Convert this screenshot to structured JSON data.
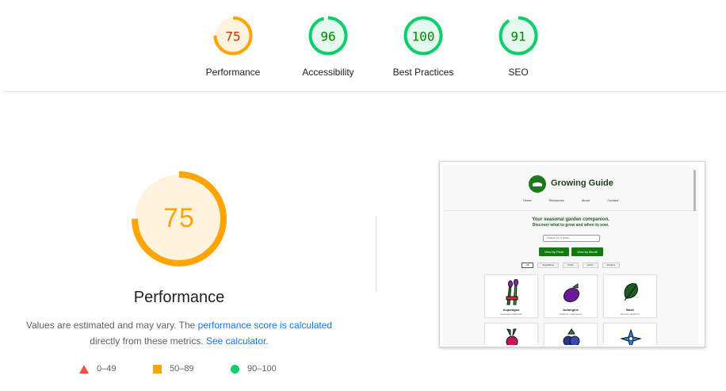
{
  "scores": [
    {
      "name": "performance",
      "label": "Performance",
      "score": 75,
      "display": "75",
      "color": "#ffa400",
      "track": "#fff3e0",
      "text": "#c33300"
    },
    {
      "name": "accessibility",
      "label": "Accessibility",
      "score": 96,
      "display": "96",
      "color": "#0cce6b",
      "track": "#e5f8ee",
      "text": "#008800"
    },
    {
      "name": "best-practices",
      "label": "Best Practices",
      "score": 100,
      "display": "100",
      "color": "#0cce6b",
      "track": "#e5f8ee",
      "text": "#008800"
    },
    {
      "name": "seo",
      "label": "SEO",
      "score": 91,
      "display": "91",
      "color": "#0cce6b",
      "track": "#e5f8ee",
      "text": "#008800"
    }
  ],
  "main": {
    "score": 75,
    "display": "75",
    "color": "#ffa400",
    "track": "#fff3e0",
    "text": "#ffa400",
    "title": "Performance",
    "desc_prefix": "Values are estimated and may vary. The ",
    "desc_link1": "performance score is calculated",
    "desc_middle": " directly from these metrics. ",
    "desc_link2": "See calculator",
    "desc_suffix": "."
  },
  "legend": {
    "fail": "0–49",
    "average": "50–89",
    "pass": "90–100",
    "fail_icon": "triangle-icon",
    "average_icon": "square-icon",
    "pass_icon": "circle-icon"
  },
  "thumbnail": {
    "site_title": "Growing Guide",
    "nav": [
      "Home",
      "Resources",
      "About",
      "Contact"
    ],
    "hero_line1": "Your seasonal garden companion.",
    "hero_line2": "Discover what to grow and when to sow.",
    "search_placeholder": "Search for a plant...",
    "button1": "View by Plant",
    "button2": "View by Month",
    "chips": [
      "All",
      "Vegetables",
      "Fruits",
      "Herbs",
      "Flowers"
    ],
    "cards": [
      {
        "name": "Asparagus",
        "latin": "Asparagus officinalis",
        "icon": "asparagus-icon"
      },
      {
        "name": "Aubergine",
        "latin": "Solanum melongena",
        "icon": "aubergine-icon"
      },
      {
        "name": "Basil",
        "latin": "Ocimum basilicum",
        "icon": "basil-icon"
      },
      {
        "name": "",
        "latin": "",
        "icon": "beetroot-icon"
      },
      {
        "name": "",
        "latin": "",
        "icon": "blueberry-icon"
      },
      {
        "name": "",
        "latin": "",
        "icon": "borage-icon"
      }
    ]
  }
}
